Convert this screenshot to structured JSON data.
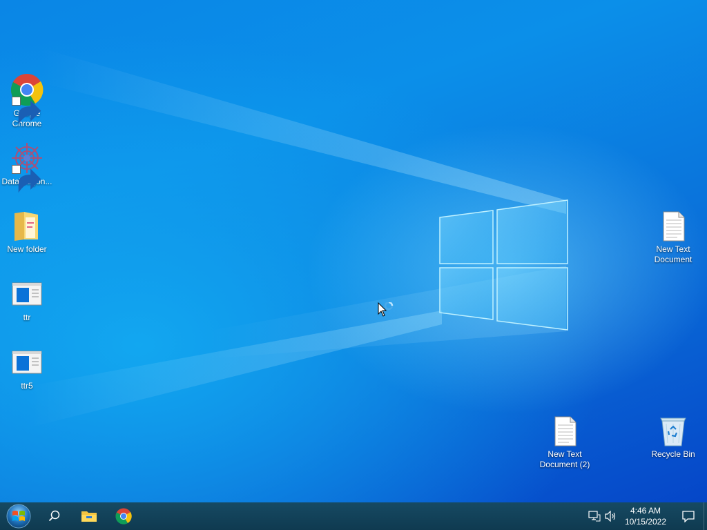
{
  "desktop": {
    "icons": [
      {
        "name": "google-chrome",
        "label_line1": "Google",
        "label_line2": "Chrome",
        "icon": "chrome-icon",
        "shortcut": true
      },
      {
        "name": "datawagon",
        "label_line1": "DataWagon...",
        "icon": "datawagon-icon",
        "shortcut": true
      },
      {
        "name": "new-folder",
        "label_line1": "New folder",
        "icon": "folder-icon"
      },
      {
        "name": "ttr",
        "label_line1": "ttr",
        "icon": "app-window-icon"
      },
      {
        "name": "ttr5",
        "label_line1": "ttr5",
        "icon": "app-window-icon"
      },
      {
        "name": "new-text-document",
        "label_line1": "New Text",
        "label_line2": "Document",
        "icon": "text-file-icon"
      },
      {
        "name": "new-text-document-2",
        "label_line1": "New Text",
        "label_line2": "Document (2)",
        "icon": "text-file-icon"
      },
      {
        "name": "recycle-bin",
        "label_line1": "Recycle Bin",
        "icon": "recycle-bin-icon"
      }
    ]
  },
  "taskbar": {
    "buttons": [
      {
        "name": "start",
        "icon": "windows-start-orb-icon"
      },
      {
        "name": "search",
        "icon": "search-icon"
      },
      {
        "name": "file-explorer",
        "icon": "file-explorer-icon"
      },
      {
        "name": "chrome",
        "icon": "chrome-icon"
      }
    ],
    "tray": {
      "icons": [
        "network-icon",
        "volume-icon"
      ],
      "time": "4:46 AM",
      "date": "10/15/2022",
      "notification_icon": "action-center-icon"
    }
  },
  "colors": {
    "wallpaper_primary": "#0a86e6",
    "wallpaper_dark": "#0546c8",
    "taskbar": "#103a4f"
  }
}
